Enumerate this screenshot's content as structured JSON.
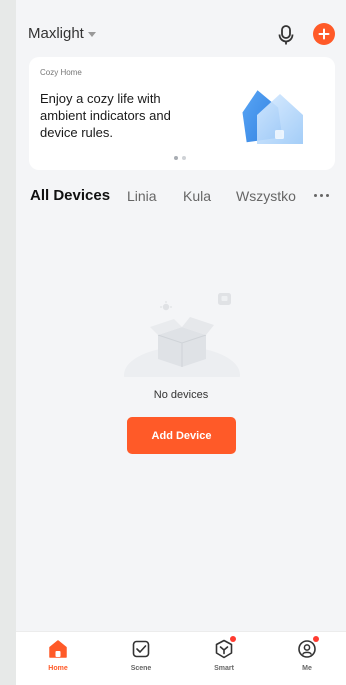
{
  "header": {
    "home_name": "Maxlight",
    "mic_icon": "microphone-icon",
    "add_icon": "plus-icon"
  },
  "banner": {
    "label": "Cozy Home",
    "text": "Enjoy a cozy life with ambient indicators and device rules.",
    "page_count": 2,
    "active_page": 1
  },
  "tabs": [
    {
      "label": "All Devices",
      "active": true
    },
    {
      "label": "Linia",
      "active": false
    },
    {
      "label": "Kula",
      "active": false
    },
    {
      "label": "Wszystko",
      "active": false
    }
  ],
  "empty": {
    "text": "No devices",
    "button": "Add Device"
  },
  "bottom_nav": [
    {
      "label": "Home",
      "icon": "home-icon",
      "active": true,
      "badge": false
    },
    {
      "label": "Scene",
      "icon": "scene-icon",
      "active": false,
      "badge": false
    },
    {
      "label": "Smart",
      "icon": "smart-icon",
      "active": false,
      "badge": true
    },
    {
      "label": "Me",
      "icon": "profile-icon",
      "active": false,
      "badge": true
    }
  ],
  "colors": {
    "accent": "#ff5a28",
    "badge": "#ff3b30",
    "background": "#f4f5f7"
  }
}
